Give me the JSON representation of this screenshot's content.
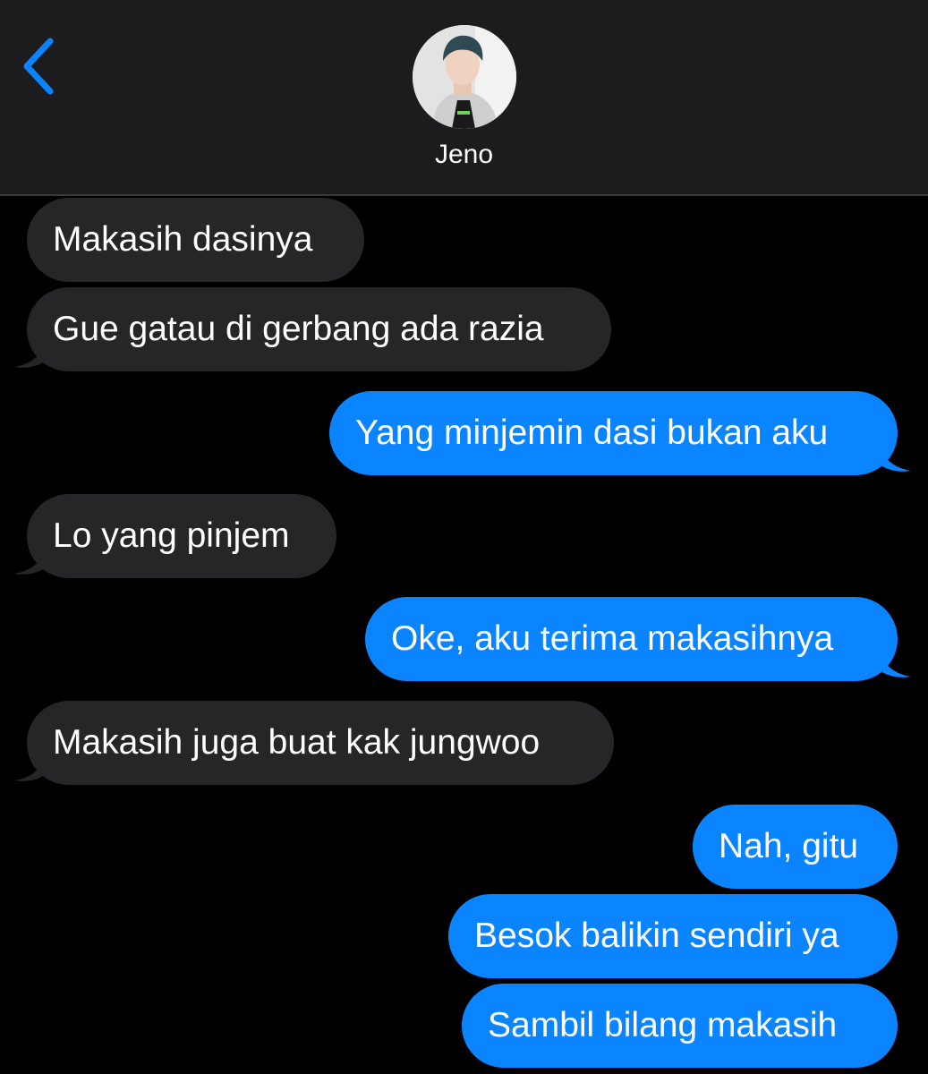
{
  "header": {
    "back_icon": "chevron-left-icon",
    "contact_name": "Jeno",
    "avatar": "contact-avatar-photo"
  },
  "colors": {
    "header_bg": "#1c1c1e",
    "screen_bg": "#000000",
    "received_bubble": "#262628",
    "sent_bubble": "#0b84ff",
    "accent": "#0a84ff"
  },
  "messages": [
    {
      "from": "them",
      "text": "Makasih dasinya"
    },
    {
      "from": "them",
      "text": "Gue gatau di gerbang ada razia"
    },
    {
      "from": "me",
      "text": "Yang minjemin dasi bukan aku"
    },
    {
      "from": "them",
      "text": "Lo yang pinjem"
    },
    {
      "from": "me",
      "text": "Oke, aku terima makasihnya"
    },
    {
      "from": "them",
      "text": "Makasih juga buat kak jungwoo"
    },
    {
      "from": "me",
      "text": "Nah, gitu"
    },
    {
      "from": "me",
      "text": "Besok balikin sendiri ya"
    },
    {
      "from": "me",
      "text": "Sambil bilang makasih"
    }
  ]
}
